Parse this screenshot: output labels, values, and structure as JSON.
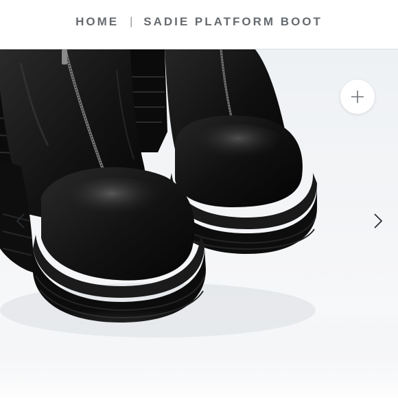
{
  "breadcrumb": {
    "home_label": "HOME",
    "separator": "|",
    "current_label": "SADIE PLATFORM BOOT"
  },
  "gallery": {
    "image_subject": "black leather platform boots with front zip",
    "zoom_icon": "plus-icon",
    "prev_icon": "chevron-left-icon",
    "next_icon": "chevron-right-icon"
  },
  "colors": {
    "breadcrumb_text": "#666b70",
    "divider": "#d9dde2",
    "background": "#eef1f4",
    "boot_leather": "#141414"
  }
}
